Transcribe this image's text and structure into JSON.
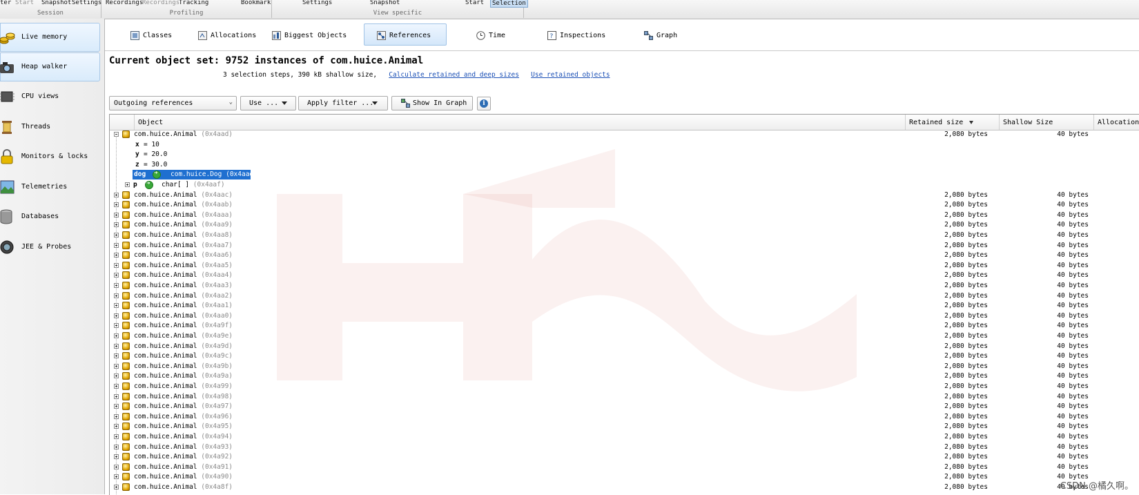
{
  "ribbon": {
    "groups": [
      {
        "label": "Session",
        "buttons": [
          "ter",
          "Start",
          "Snapshot",
          "Settings"
        ]
      },
      {
        "label": "Profiling",
        "buttons": [
          "Recordings",
          "Recordings",
          "Tracking",
          "",
          "Bookmark"
        ]
      },
      {
        "label": "View specific",
        "buttons": [
          "",
          "Settings",
          "",
          "Snapshot",
          "",
          "Start",
          "Selection"
        ]
      }
    ]
  },
  "sidebar": {
    "items": [
      {
        "label": "Live memory",
        "icon": "coins-icon",
        "active": true
      },
      {
        "label": "Heap walker",
        "icon": "camera-icon",
        "active": true
      },
      {
        "label": "CPU views",
        "icon": "cpu-chip-icon"
      },
      {
        "label": "Threads",
        "icon": "threads-spool-icon"
      },
      {
        "label": "Monitors & locks",
        "icon": "padlock-icon"
      },
      {
        "label": "Telemetries",
        "icon": "landscape-icon"
      },
      {
        "label": "Databases",
        "icon": "database-icon"
      },
      {
        "label": "JEE & Probes",
        "icon": "probe-lens-icon"
      }
    ]
  },
  "tabs": [
    {
      "label": "Classes",
      "icon": "classes-icon"
    },
    {
      "label": "Allocations",
      "icon": "allocations-icon"
    },
    {
      "label": "Biggest Objects",
      "icon": "biggest-objects-icon"
    },
    {
      "label": "References",
      "icon": "references-icon",
      "active": true
    },
    {
      "label": "Time",
      "icon": "clock-icon"
    },
    {
      "label": "Inspections",
      "icon": "inspections-icon"
    },
    {
      "label": "Graph",
      "icon": "graph-icon"
    }
  ],
  "header": {
    "title": "Current object set: 9752 instances of com.huice.Animal",
    "info": "3 selection steps, 390 kB shallow size,",
    "link_calculate": "Calculate retained and deep sizes",
    "link_use_retained": "Use retained objects"
  },
  "toolbar": {
    "view_select": "Outgoing references",
    "use_button": "Use ...",
    "filter_button": "Apply filter ...",
    "graph_button": "Show In Graph"
  },
  "table": {
    "columns": {
      "object": "Object",
      "retained": "Retained size",
      "shallow": "Shallow Size",
      "alloc": "Allocation Ti"
    },
    "expanded": {
      "class": "com.huice.Animal",
      "addr": "(0x4aad)",
      "retained": "2,080 bytes",
      "shallow": "40 bytes",
      "fields": [
        {
          "name": "x",
          "value": "= 10"
        },
        {
          "name": "y",
          "value": "= 20.0"
        },
        {
          "name": "z",
          "value": "= 30.0"
        }
      ],
      "dog_ref": {
        "name": "dog",
        "target": "com.huice.Dog",
        "addr": "(0x4aae)"
      },
      "p_ref": {
        "name": "p",
        "target": "char[ ]",
        "addr": "(0x4aaf)"
      }
    },
    "rows": [
      {
        "cls": "com.huice.Animal",
        "addr": "(0x4aac)",
        "retained": "2,080 bytes",
        "shallow": "40 bytes"
      },
      {
        "cls": "com.huice.Animal",
        "addr": "(0x4aab)",
        "retained": "2,080 bytes",
        "shallow": "40 bytes"
      },
      {
        "cls": "com.huice.Animal",
        "addr": "(0x4aaa)",
        "retained": "2,080 bytes",
        "shallow": "40 bytes"
      },
      {
        "cls": "com.huice.Animal",
        "addr": "(0x4aa9)",
        "retained": "2,080 bytes",
        "shallow": "40 bytes"
      },
      {
        "cls": "com.huice.Animal",
        "addr": "(0x4aa8)",
        "retained": "2,080 bytes",
        "shallow": "40 bytes"
      },
      {
        "cls": "com.huice.Animal",
        "addr": "(0x4aa7)",
        "retained": "2,080 bytes",
        "shallow": "40 bytes"
      },
      {
        "cls": "com.huice.Animal",
        "addr": "(0x4aa6)",
        "retained": "2,080 bytes",
        "shallow": "40 bytes"
      },
      {
        "cls": "com.huice.Animal",
        "addr": "(0x4aa5)",
        "retained": "2,080 bytes",
        "shallow": "40 bytes"
      },
      {
        "cls": "com.huice.Animal",
        "addr": "(0x4aa4)",
        "retained": "2,080 bytes",
        "shallow": "40 bytes"
      },
      {
        "cls": "com.huice.Animal",
        "addr": "(0x4aa3)",
        "retained": "2,080 bytes",
        "shallow": "40 bytes"
      },
      {
        "cls": "com.huice.Animal",
        "addr": "(0x4aa2)",
        "retained": "2,080 bytes",
        "shallow": "40 bytes"
      },
      {
        "cls": "com.huice.Animal",
        "addr": "(0x4aa1)",
        "retained": "2,080 bytes",
        "shallow": "40 bytes"
      },
      {
        "cls": "com.huice.Animal",
        "addr": "(0x4aa0)",
        "retained": "2,080 bytes",
        "shallow": "40 bytes"
      },
      {
        "cls": "com.huice.Animal",
        "addr": "(0x4a9f)",
        "retained": "2,080 bytes",
        "shallow": "40 bytes"
      },
      {
        "cls": "com.huice.Animal",
        "addr": "(0x4a9e)",
        "retained": "2,080 bytes",
        "shallow": "40 bytes"
      },
      {
        "cls": "com.huice.Animal",
        "addr": "(0x4a9d)",
        "retained": "2,080 bytes",
        "shallow": "40 bytes"
      },
      {
        "cls": "com.huice.Animal",
        "addr": "(0x4a9c)",
        "retained": "2,080 bytes",
        "shallow": "40 bytes"
      },
      {
        "cls": "com.huice.Animal",
        "addr": "(0x4a9b)",
        "retained": "2,080 bytes",
        "shallow": "40 bytes"
      },
      {
        "cls": "com.huice.Animal",
        "addr": "(0x4a9a)",
        "retained": "2,080 bytes",
        "shallow": "40 bytes"
      },
      {
        "cls": "com.huice.Animal",
        "addr": "(0x4a99)",
        "retained": "2,080 bytes",
        "shallow": "40 bytes"
      },
      {
        "cls": "com.huice.Animal",
        "addr": "(0x4a98)",
        "retained": "2,080 bytes",
        "shallow": "40 bytes"
      },
      {
        "cls": "com.huice.Animal",
        "addr": "(0x4a97)",
        "retained": "2,080 bytes",
        "shallow": "40 bytes"
      },
      {
        "cls": "com.huice.Animal",
        "addr": "(0x4a96)",
        "retained": "2,080 bytes",
        "shallow": "40 bytes"
      },
      {
        "cls": "com.huice.Animal",
        "addr": "(0x4a95)",
        "retained": "2,080 bytes",
        "shallow": "40 bytes"
      },
      {
        "cls": "com.huice.Animal",
        "addr": "(0x4a94)",
        "retained": "2,080 bytes",
        "shallow": "40 bytes"
      },
      {
        "cls": "com.huice.Animal",
        "addr": "(0x4a93)",
        "retained": "2,080 bytes",
        "shallow": "40 bytes"
      },
      {
        "cls": "com.huice.Animal",
        "addr": "(0x4a92)",
        "retained": "2,080 bytes",
        "shallow": "40 bytes"
      },
      {
        "cls": "com.huice.Animal",
        "addr": "(0x4a91)",
        "retained": "2,080 bytes",
        "shallow": "40 bytes"
      },
      {
        "cls": "com.huice.Animal",
        "addr": "(0x4a90)",
        "retained": "2,080 bytes",
        "shallow": "40 bytes"
      },
      {
        "cls": "com.huice.Animal",
        "addr": "(0x4a8f)",
        "retained": "2,080 bytes",
        "shallow": "40 bytes"
      }
    ]
  },
  "watermark_credit": "CSDN @橘久啊。",
  "colors": {
    "selection": "#1e6fd0",
    "link": "#1a4fb5",
    "active_bg": "#d4e7fa",
    "watermark": "#c0392b"
  }
}
